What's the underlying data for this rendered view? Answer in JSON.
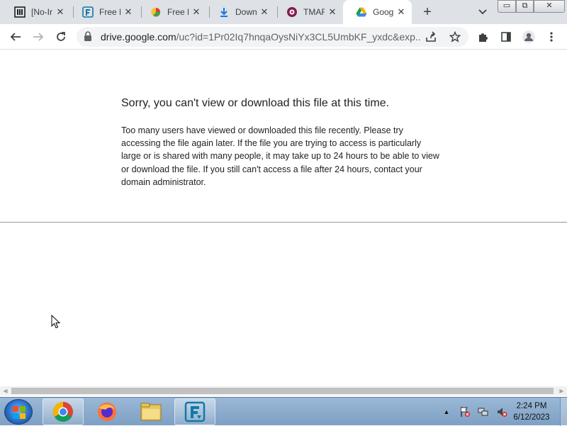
{
  "tabs": [
    {
      "title": "[No-Ir",
      "icon": "book-icon",
      "active": false
    },
    {
      "title": "Free D",
      "icon": "freedownload-icon",
      "active": false
    },
    {
      "title": "Free D",
      "icon": "pie-icon",
      "active": false
    },
    {
      "title": "Down",
      "icon": "download-arrow-icon",
      "active": false
    },
    {
      "title": "TMAF",
      "icon": "circle-logo-icon",
      "active": false
    },
    {
      "title": "Goog",
      "icon": "google-drive-icon",
      "active": true
    }
  ],
  "tab_close_glyph": "✕",
  "new_tab_glyph": "+",
  "tab_search_glyph": "⌄",
  "window_buttons": {
    "minimize": "▭",
    "restore": "⧉",
    "close": "✕"
  },
  "toolbar": {
    "url_host": "drive.google.com",
    "url_path": "/uc?id=1Pr02Iq7hnqaOysNiYx3CL5UmbKF_yxdc&exp..."
  },
  "page": {
    "title": "Sorry, you can't view or download this file at this time.",
    "body": "Too many users have viewed or downloaded this file recently. Please try accessing the file again later. If the file you are trying to access is particularly large or is shared with many people, it may take up to 24 hours to be able to view or download the file. If you still can't access a file after 24 hours, contact your domain administrator."
  },
  "scrollbar": {
    "left_arrow": "◀",
    "right_arrow": "▶"
  },
  "taskbar": {
    "apps": [
      "chrome-icon",
      "firefox-icon",
      "file-explorer-icon",
      "freedownload-manager-icon"
    ],
    "tray_up_arrow": "▲",
    "time": "2:24 PM",
    "date": "6/12/2023"
  },
  "colors": {
    "tabstrip": "#dee1e6",
    "drive_blue": "#4285f4",
    "drive_green": "#0f9d58",
    "drive_yellow": "#f4b400",
    "download_blue": "#1a73e8"
  }
}
